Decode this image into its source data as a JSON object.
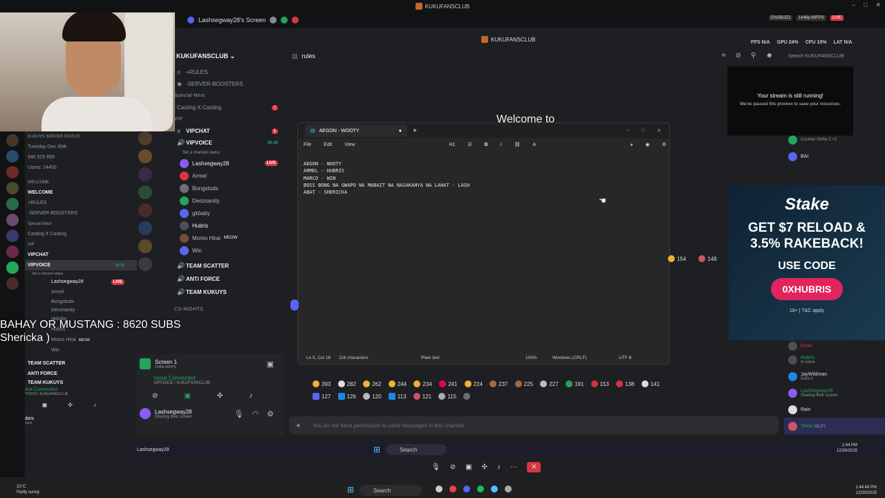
{
  "window": {
    "title": "KUKUFANSCLUB"
  },
  "screen_share": {
    "label": "Lashsegway28's Screen"
  },
  "server": {
    "name": "KUKUFANSCLUB",
    "subtitle": "KUKUFANSCLUB"
  },
  "channels": [
    {
      "type": "channel",
      "label": "+RULES",
      "bold": false
    },
    {
      "type": "channel",
      "label": "-SERVER-BOOSTERS",
      "bold": false
    },
    {
      "type": "category",
      "label": "Special-Nest"
    },
    {
      "type": "channel",
      "label": "Casting X Casting",
      "bold": false,
      "badge": "1"
    },
    {
      "type": "category",
      "label": "VIP"
    },
    {
      "type": "channel",
      "label": "VIPCHAT",
      "bold": true,
      "badge": "1"
    },
    {
      "type": "voice",
      "label": "VIPVOICE",
      "bold": true,
      "time": "56:49"
    },
    {
      "type": "status",
      "label": "Set a channel status"
    }
  ],
  "voice_users": [
    {
      "name": "Lashsegway28",
      "badge": "LIVE"
    },
    {
      "name": "Armel"
    },
    {
      "name": "Bongstods"
    },
    {
      "name": "Denzsanity"
    },
    {
      "name": "gkbaby"
    },
    {
      "name": "Hubris"
    },
    {
      "name": "Momo Hirai",
      "tag": "MEOW"
    },
    {
      "name": "Win"
    }
  ],
  "more_channels": [
    "TEAM SCATTER",
    "ANTI FORCE",
    "TEAM KUKUYS",
    "CS-NIGHTS"
  ],
  "mini": {
    "status_header": "KUKUYS SERVER STATUS",
    "date": "Tuesday Dec 30th",
    "counts": "946  525  659",
    "users": "Users: 14450",
    "welcome_cat": "WELCOME",
    "welcome": "WELCOME",
    "rules": "+RULES",
    "boosters": "-SERVER-BOOSTERS",
    "special": "Special-Nest",
    "casting": "Casting X Casting",
    "vip": "VIP",
    "vipchat": "VIPCHAT",
    "vipvoice": "VIPVOICE",
    "vipvoice_time": "56:52",
    "status": "Set a channel status",
    "users_list": [
      "Lashsegway28",
      "Armel",
      "Bongstods",
      "Denzsanity",
      "gkbaby",
      "Hubris",
      "Momo Hirai",
      "Win"
    ],
    "meow": "MEOW",
    "live": "LIVE",
    "team_scatter": "TEAM SCATTER",
    "anti_force": "ANTI FORCE",
    "team_kukuys": "TEAM KUKUYS",
    "voice_connected": "Voice Connected",
    "voice_sub": "VIPVOICE / KUKUFANSCLUB",
    "user": "Hubris",
    "user_status": "In voice"
  },
  "overlay_subs": {
    "line1": "BAHAY OR MUSTANG : 8620 SUBS",
    "line2": "Shericka )"
  },
  "main": {
    "channel": "rules",
    "welcome": "Welcome to"
  },
  "search": {
    "placeholder": "Search KUKUFANSCLUB"
  },
  "stats": {
    "fps": "FPS N/A",
    "gpu": "GPU 24%",
    "cpu": "CPU 10%",
    "lat": "LAT N/A"
  },
  "stream_note": {
    "title": "Your stream is still running!",
    "sub": "We've paused this preview to save your resources."
  },
  "top_right": {
    "enabled": "ENABLED",
    "quality": "1440p 60FPS",
    "live": "LIVE"
  },
  "notepad": {
    "tab": "AEGON - WOOTY",
    "menu": [
      "File",
      "Edit",
      "View"
    ],
    "heading": "H1",
    "lines": [
      "AEGON - WOOTY",
      "ARMEL - HUBRIS",
      "MARCO - WIN",
      "BOSS BONG NA GWAPO NA MABAIT NA NASAKANYA NA LAHAT - LASH",
      "ABAT - SHERICKA"
    ],
    "status": {
      "pos": "Ln 5, Col 16",
      "chars": "116 characters",
      "format": "Plain text",
      "zoom": "100%",
      "eol": "Windows (CRLF)",
      "enc": "UTF-8"
    }
  },
  "reactions_row1": [
    {
      "n": "393"
    },
    {
      "n": "282"
    },
    {
      "n": "262"
    },
    {
      "n": "244"
    },
    {
      "n": "234"
    },
    {
      "n": "241"
    },
    {
      "n": "224"
    },
    {
      "n": "237"
    },
    {
      "n": "225"
    },
    {
      "n": "227"
    },
    {
      "n": "191"
    },
    {
      "n": "153"
    },
    {
      "n": "138"
    },
    {
      "n": "141"
    }
  ],
  "reactions_row2": [
    {
      "n": "127"
    },
    {
      "n": "126"
    },
    {
      "n": "120"
    },
    {
      "n": "113"
    },
    {
      "n": "121"
    },
    {
      "n": "115"
    }
  ],
  "reactions_side": [
    {
      "n": "154"
    },
    {
      "n": "148"
    }
  ],
  "msgbar": {
    "placeholder": "You do not have permission to send messages in this channel."
  },
  "voice_panel": {
    "screen": "Screen 1",
    "quality": "1440p 60FPS",
    "connected": "Voice Connected",
    "channel": "VIPVOICE / KUKUFANSCLUB",
    "user": "Lashsegway28",
    "user_status": "Sharing their screen"
  },
  "members": [
    {
      "name": "Counter-Strike 2 +1",
      "sub": ""
    },
    {
      "name": "BAI",
      "sub": ""
    },
    {
      "name": "Emel",
      "sub": ""
    },
    {
      "name": "Hubris",
      "sub": "In voice"
    },
    {
      "name": "JayWildman",
      "sub": "Dota 2"
    },
    {
      "name": "Lashsegway28",
      "sub": "Sharing their screen"
    },
    {
      "name": "Rain",
      "sub": ""
    },
    {
      "name": "Shine",
      "sub": "MLDY"
    }
  ],
  "stake": {
    "logo": "Stake",
    "line1": "GET $7 RELOAD &",
    "line2": "3.5% RAKEBACK!",
    "code_label": "USE CODE",
    "code": "0XHUBRIS",
    "tc": "18+ | T&C apply"
  },
  "inner_taskbar": {
    "search": "Search",
    "time": "1:44 PM",
    "date": "12/30/2025",
    "app": "Lashsegway28"
  },
  "outer_taskbar": {
    "search": "Search",
    "time": "1:44:49 PM",
    "date": "12/30/2025",
    "temp": "31°C",
    "weather": "Partly sunny"
  }
}
